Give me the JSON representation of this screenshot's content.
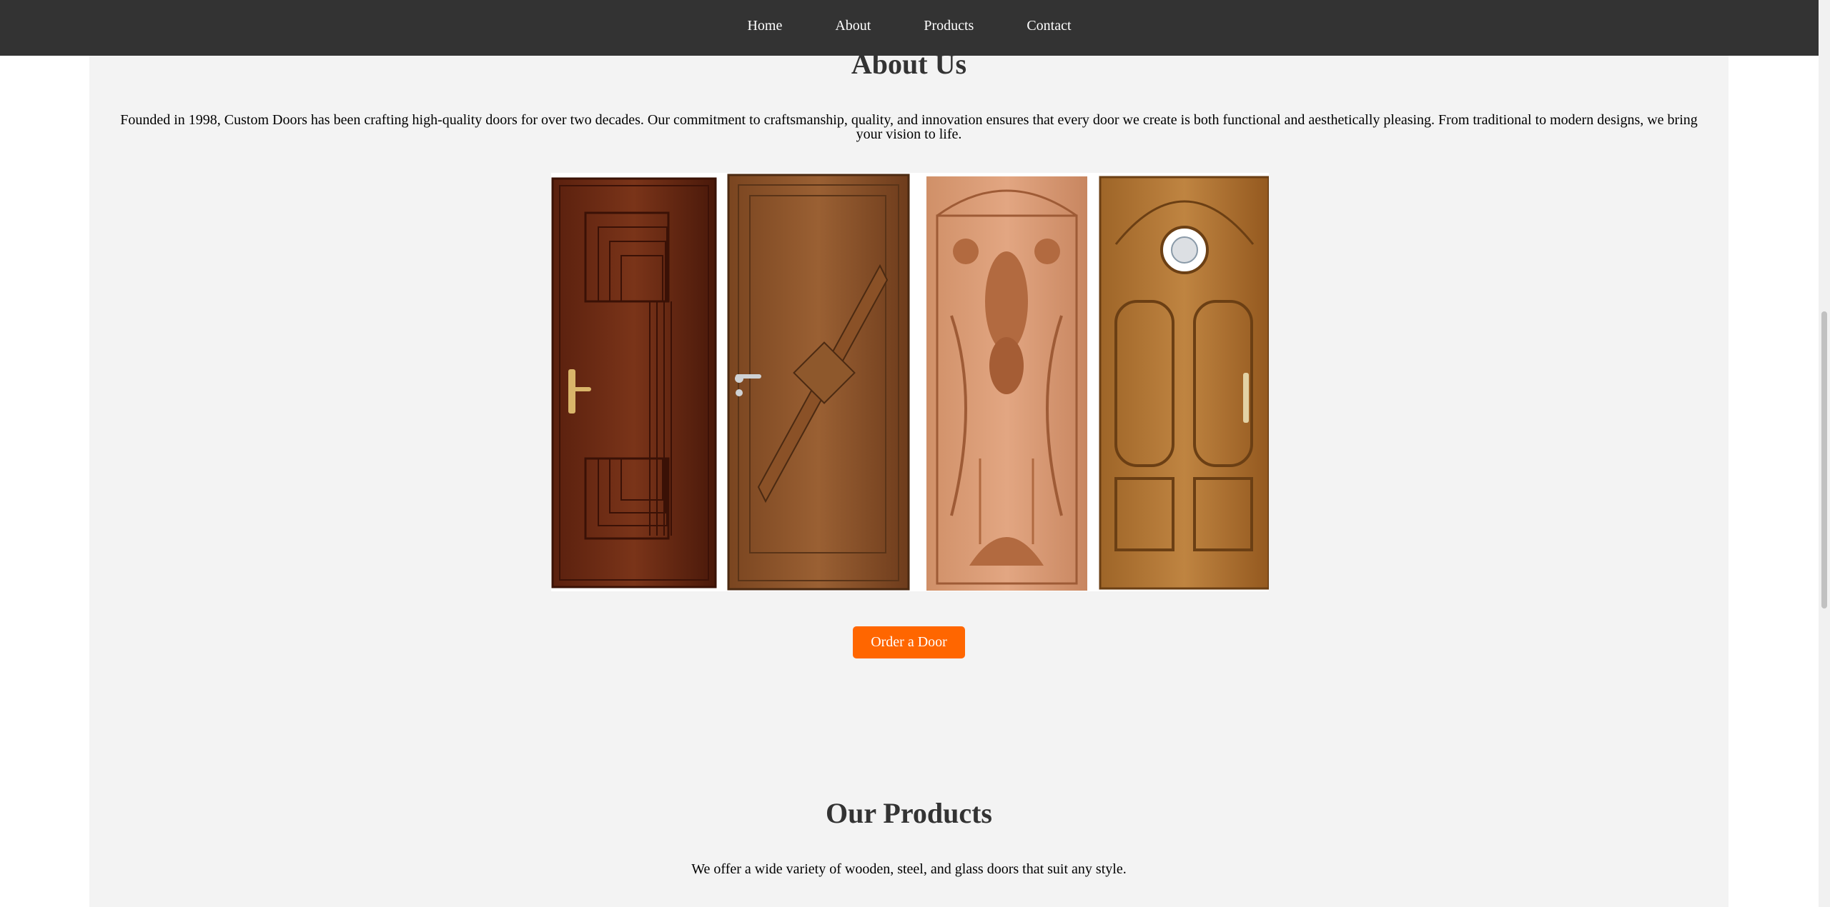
{
  "nav": {
    "items": [
      {
        "label": "Home"
      },
      {
        "label": "About"
      },
      {
        "label": "Products"
      },
      {
        "label": "Contact"
      }
    ]
  },
  "about": {
    "title": "About Us",
    "text": "Founded in 1998, Custom Doors has been crafting high-quality doors for over two decades. Our commitment to craftsmanship, quality, and innovation ensures that every door we create is both functional and aesthetically pleasing. From traditional to modern designs, we bring your vision to life.",
    "image_name": "custom-doors-collage",
    "cta_label": "Order a Door"
  },
  "products": {
    "title": "Our Products",
    "text": "We offer a wide variety of wooden, steel, and glass doors that suit any style."
  },
  "colors": {
    "nav_bg": "#333333",
    "page_bg": "#f3f3f3",
    "accent": "#ff6600",
    "heading": "#333333"
  }
}
